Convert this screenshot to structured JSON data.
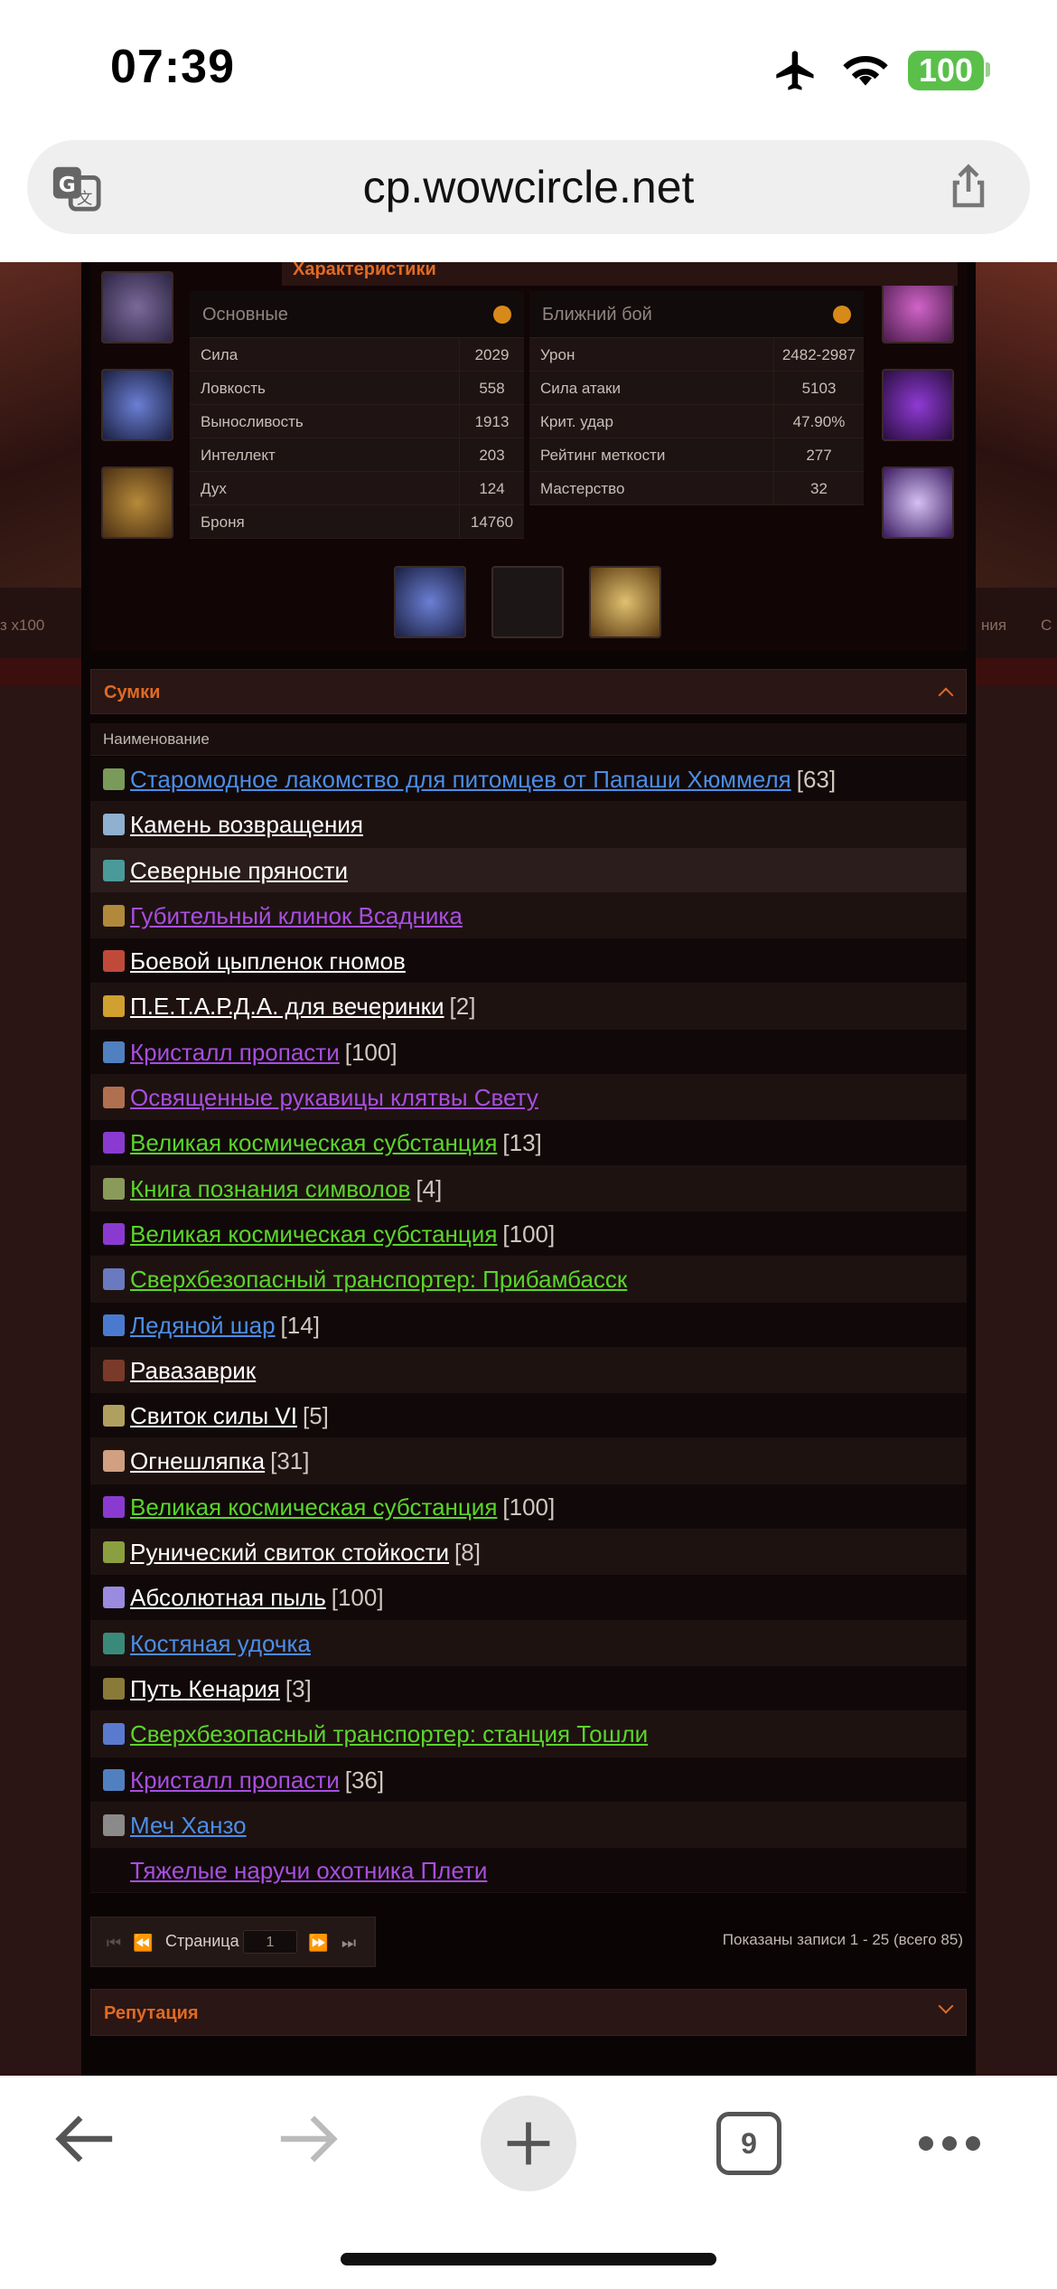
{
  "status": {
    "time": "07:39",
    "battery": "100"
  },
  "browser": {
    "url": "cp.wowcircle.net"
  },
  "stats": {
    "header": "Характеристики",
    "left_dropdown": "Основные",
    "right_dropdown": "Ближний бой",
    "left_rows": [
      {
        "label": "Сила",
        "value": "2029"
      },
      {
        "label": "Ловкость",
        "value": "558"
      },
      {
        "label": "Выносливость",
        "value": "1913"
      },
      {
        "label": "Интеллект",
        "value": "203"
      },
      {
        "label": "Дух",
        "value": "124"
      },
      {
        "label": "Броня",
        "value": "14760"
      }
    ],
    "right_rows": [
      {
        "label": "Урон",
        "value": "2482-2987"
      },
      {
        "label": "Сила атаки",
        "value": "5103"
      },
      {
        "label": "Крит. удар",
        "value": "47.90%"
      },
      {
        "label": "Рейтинг меткости",
        "value": "277"
      },
      {
        "label": "Мастерство",
        "value": "32"
      }
    ]
  },
  "bags": {
    "header": "Сумки",
    "column": "Наименование",
    "items": [
      {
        "name": "Старомодное лакомство для питомцев от Папаши Хюммеля",
        "qty": "[63]",
        "quality": "blue"
      },
      {
        "name": "Камень возвращения",
        "qty": "",
        "quality": "white"
      },
      {
        "name": "Северные пряности",
        "qty": "",
        "quality": "white"
      },
      {
        "name": "Губительный клинок Всадника",
        "qty": "",
        "quality": "purple"
      },
      {
        "name": "Боевой цыпленок гномов",
        "qty": "",
        "quality": "white"
      },
      {
        "name": "П.Е.Т.А.Р.Д.А. для вечеринки",
        "qty": "[2]",
        "quality": "white"
      },
      {
        "name": "Кристалл пропасти",
        "qty": "[100]",
        "quality": "purple"
      },
      {
        "name": "Освященные рукавицы клятвы Свету",
        "qty": "",
        "quality": "purple"
      },
      {
        "name": "Великая космическая субстанция",
        "qty": "[13]",
        "quality": "green"
      },
      {
        "name": "Книга познания символов",
        "qty": "[4]",
        "quality": "green"
      },
      {
        "name": "Великая космическая субстанция",
        "qty": "[100]",
        "quality": "green"
      },
      {
        "name": "Сверхбезопасный транспортер: Прибамбасск",
        "qty": "",
        "quality": "green"
      },
      {
        "name": "Ледяной шар",
        "qty": "[14]",
        "quality": "blue"
      },
      {
        "name": "Равазаврик",
        "qty": "",
        "quality": "white"
      },
      {
        "name": "Свиток силы VI",
        "qty": "[5]",
        "quality": "white"
      },
      {
        "name": "Огнешляпка",
        "qty": "[31]",
        "quality": "white"
      },
      {
        "name": "Великая космическая субстанция",
        "qty": "[100]",
        "quality": "green"
      },
      {
        "name": "Рунический свиток стойкости",
        "qty": "[8]",
        "quality": "white"
      },
      {
        "name": "Абсолютная пыль",
        "qty": "[100]",
        "quality": "white"
      },
      {
        "name": "Костяная удочка",
        "qty": "",
        "quality": "blue"
      },
      {
        "name": "Путь Кенария",
        "qty": "[3]",
        "quality": "white"
      },
      {
        "name": "Сверхбезопасный транспортер: станция Тошли",
        "qty": "",
        "quality": "green"
      },
      {
        "name": "Кристалл пропасти",
        "qty": "[36]",
        "quality": "purple"
      },
      {
        "name": "Меч Ханзо",
        "qty": "",
        "quality": "blue"
      },
      {
        "name": "Тяжелые наручи охотника Плети",
        "qty": "",
        "quality": "purple"
      }
    ]
  },
  "pager": {
    "label": "Страница",
    "page": "1",
    "summary": "Показаны записи 1 - 25 (всего 85)"
  },
  "reputation": {
    "header": "Репутация"
  },
  "side": {
    "left_1": "з x100",
    "right_1": "ния",
    "right_2": "С"
  },
  "tabs": {
    "count": "9"
  },
  "colors": {
    "accent": "#e06a24",
    "blue": "#4b8ee6",
    "green": "#5ad52b",
    "purple": "#a84ee0"
  }
}
